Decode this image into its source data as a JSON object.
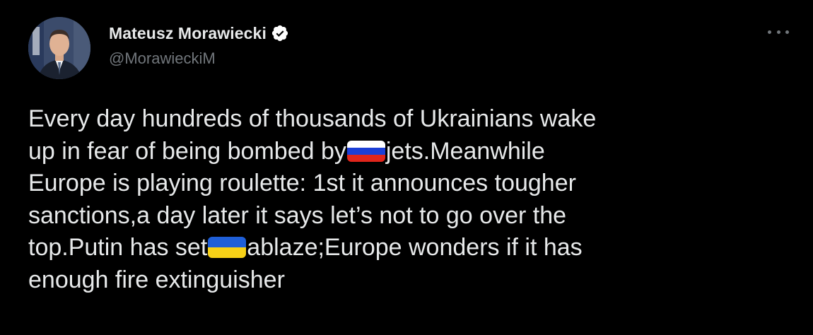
{
  "author": {
    "display_name": "Mateusz Morawiecki",
    "handle": "@MorawieckiM"
  },
  "icons": {
    "verified": "verified-badge-icon",
    "more": "more-options-icon",
    "avatar": "profile-photo"
  },
  "colors": {
    "background": "#000000",
    "text": "#e7e9ea",
    "secondary_text": "#71767b",
    "verified_badge": "#ffffff",
    "flag_russia": [
      "#ffffff",
      "#1c3fd6",
      "#e0251b"
    ],
    "flag_ukraine": [
      "#1f5fd8",
      "#f7d117"
    ]
  },
  "tweet": {
    "lines": [
      {
        "text": "Every day hundreds of thousands of Ukrainians wake"
      },
      {
        "before": "up in fear of being bombed by",
        "flag": "russia-flag",
        "after": "jets.Meanwhile"
      },
      {
        "text": "Europe is playing roulette: 1st it announces tougher"
      },
      {
        "text": "sanctions,a day later it says let’s not to go over the"
      },
      {
        "before": "top.Putin has set",
        "flag": "ukraine-flag",
        "after": "ablaze;Europe wonders if it has"
      },
      {
        "text": "enough fire extinguisher"
      }
    ]
  }
}
